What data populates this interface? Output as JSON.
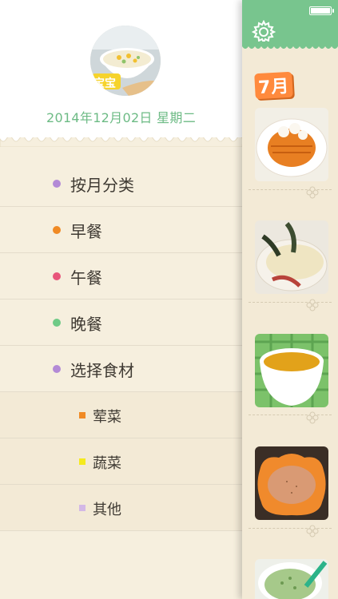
{
  "status": {
    "battery_icon": "battery-icon"
  },
  "drawer": {
    "date": "2014年12月02日 星期二",
    "avatar": {
      "badge_text": "宝宝"
    },
    "menu": [
      {
        "label": "按月分类",
        "color": "#b38ad6"
      },
      {
        "label": "早餐",
        "color": "#f08a24"
      },
      {
        "label": "午餐",
        "color": "#e8557a"
      },
      {
        "label": "晚餐",
        "color": "#6fca86"
      },
      {
        "label": "选择食材",
        "color": "#b38ad6"
      }
    ],
    "sub_menu": [
      {
        "label": "荤菜",
        "color": "#f08a24"
      },
      {
        "label": "蔬菜",
        "color": "#f5ea1e"
      },
      {
        "label": "其他",
        "color": "#d3b8e6"
      }
    ]
  },
  "panel": {
    "settings_icon": "gear-icon",
    "month_label": "7月",
    "accent": "#78c58e"
  }
}
